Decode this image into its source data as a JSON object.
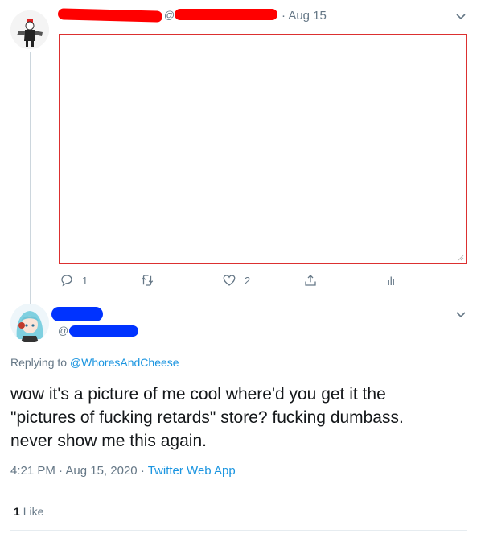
{
  "tweet1": {
    "at_symbol": "@",
    "date": "· Aug 15",
    "replies_count": "1",
    "likes_count": "2",
    "colors": {
      "redaction": "#ff0000",
      "embed_border": "#dc3030"
    }
  },
  "tweet2": {
    "at_symbol": "@",
    "replying_to_prefix": "Replying to",
    "replying_to_handle": "@WhoresAndCheese",
    "body_line1": "wow it's a picture of me cool where'd you get it the",
    "body_line2": "\"pictures of fucking retards\" store? fucking dumbass.",
    "body_line3": "never show me this again.",
    "time": "4:21 PM",
    "dot": "·",
    "date": "Aug 15, 2020",
    "source": "Twitter Web App",
    "likes_count": "1",
    "likes_label": "Like",
    "colors": {
      "redaction": "#0033ff",
      "link": "#1b95e0"
    }
  },
  "icons": [
    "chevron-down-icon",
    "reply-icon",
    "retweet-icon",
    "like-icon",
    "share-icon",
    "analytics-icon"
  ]
}
